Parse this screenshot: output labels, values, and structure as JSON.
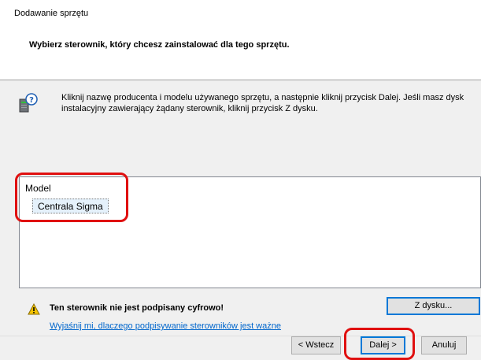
{
  "window": {
    "title": "Dodawanie sprzętu"
  },
  "header": {
    "instruction": "Wybierz sterownik, który chcesz zainstalować dla tego sprzętu."
  },
  "info": {
    "icon": "hardware-help-icon",
    "text": "Kliknij nazwę producenta i modelu używanego sprzętu, a następnie kliknij przycisk Dalej. Jeśli masz dysk instalacyjny zawierający żądany sterownik, kliknij przycisk Z dysku."
  },
  "model_list": {
    "header": "Model",
    "items": [
      "Centrala Sigma"
    ],
    "selected": "Centrala Sigma"
  },
  "warning": {
    "icon": "warning-icon",
    "title": "Ten sterownik nie jest podpisany cyfrowo!",
    "link": "Wyjaśnij mi, dlaczego podpisywanie sterowników jest ważne"
  },
  "buttons": {
    "have_disk": "Z dysku...",
    "back": "< Wstecz",
    "next": "Dalej >",
    "cancel": "Anuluj"
  },
  "colors": {
    "highlight": "#e01010",
    "accent": "#0078d7",
    "link": "#0066cc",
    "selection": "#e5f1fb"
  }
}
